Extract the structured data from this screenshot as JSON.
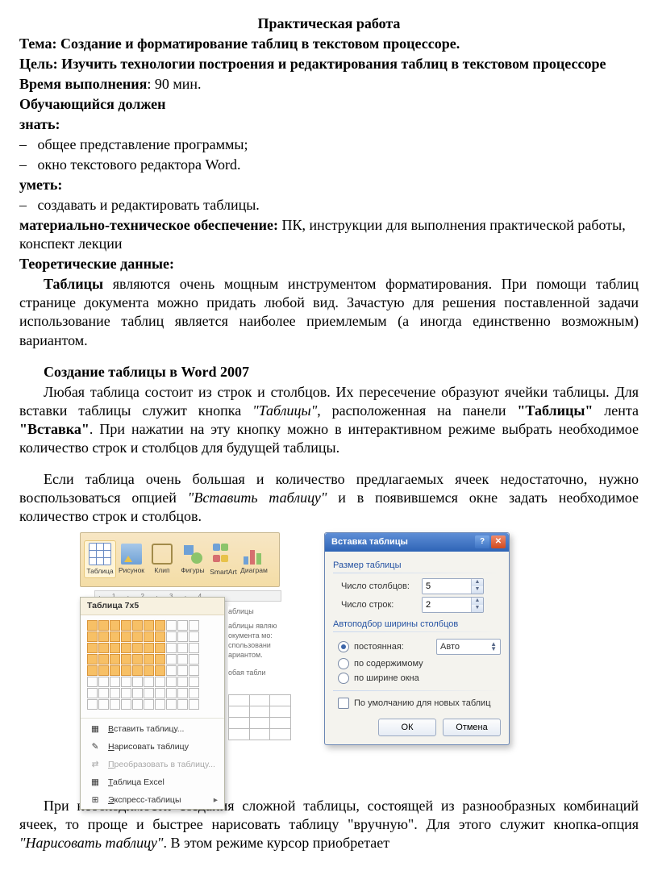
{
  "title": "Практическая работа",
  "topic_label": "Тема:",
  "topic_text": "Создание и форматирование таблиц в текстовом процессоре.",
  "goal_label": "Цель:",
  "goal_text": "Изучить технологии построения и редактирования таблиц в текстовом процессоре",
  "time_label": "Время выполнения",
  "time_text": ": 90 мин.",
  "student_must": "Обучающийся должен",
  "know_label": "знать:",
  "know_items": [
    "общее представление программы;",
    "окно текстового редактора Word."
  ],
  "can_label": "уметь:",
  "can_items": [
    "создавать и редактировать таблицы."
  ],
  "materials_label": "материально-техническое обеспечение:",
  "materials_text": " ПК, инструкции для выполнения практической работы, конспект лекции",
  "theory_label": "Теоретические данные:",
  "p1_a": "Таблицы",
  "p1_b": " являются очень мощным инструментом форматирования. При помощи таблиц странице документа можно придать любой вид. Зачастую для решения поставленной задачи использование таблиц является наиболее приемлемым (а иногда единственно возможным) вариантом.",
  "h_create": "Создание таблицы в Word 2007",
  "p2_a": "Любая таблица состоит из строк и столбцов. Их пересечение образуют ячейки таблицы. Для вставки таблицы служит кнопка ",
  "p2_b": "\"Таблицы\"",
  "p2_c": ", расположенная на  панели ",
  "p2_d": "\"Таблицы\"",
  "p2_e": " лента ",
  "p2_f": "\"Вставка\"",
  "p2_g": ". При нажатии на эту кнопку можно в интерактивном режиме выбрать необходимое количество строк и столбцов для будущей таблицы.",
  "p3_a": "Если таблица очень большая и количество предлагаемых ячеек недостаточно, нужно воспользоваться опцией ",
  "p3_b": "\"Вставить таблицу\"",
  "p3_c": " и в появившемся окне задать необходимое количество строк и столбцов.",
  "p4_a": "При необходимости создания сложной таблицы, состоящей из разнообразных комбинаций ячеек, то проще и быстрее нарисовать таблицу \"вручную\". Для этого служит кнопка-опция ",
  "p4_b": "\"Нарисовать таблицу\"",
  "p4_c": ". В этом режиме курсор приобретает",
  "figA": {
    "ribbon": [
      "Таблица",
      "Рисунок",
      "Клип",
      "Фигуры",
      "SmartArt",
      "Диаграм"
    ],
    "dd_title": "Таблица 7x5",
    "grid_cols": 7,
    "grid_rows": 5,
    "menu": [
      {
        "label": "Вставить таблицу...",
        "enabled": true
      },
      {
        "label": "Нарисовать таблицу",
        "enabled": true
      },
      {
        "label": "Преобразовать в таблицу...",
        "enabled": false
      },
      {
        "label": "Таблица Excel",
        "enabled": true
      },
      {
        "label": "Экспресс-таблицы",
        "enabled": true,
        "arrow": true
      }
    ],
    "ruler": "· 1 · 2 · 3 · 4",
    "snip": [
      "аблицы",
      "аблицы являю",
      "окумента мо:",
      "спользовани",
      "ариантом.",
      "обая табли"
    ]
  },
  "figB": {
    "title": "Вставка таблицы",
    "g1": "Размер таблицы",
    "cols_label": "Число столбцов:",
    "cols_value": "5",
    "rows_label": "Число строк:",
    "rows_value": "2",
    "g2": "Автоподбор ширины столбцов",
    "r1": "постоянная:",
    "r1_val": "Авто",
    "r2": "по содержимому",
    "r3": "по ширине окна",
    "chk": "По умолчанию для новых таблиц",
    "ok": "ОК",
    "cancel": "Отмена"
  }
}
